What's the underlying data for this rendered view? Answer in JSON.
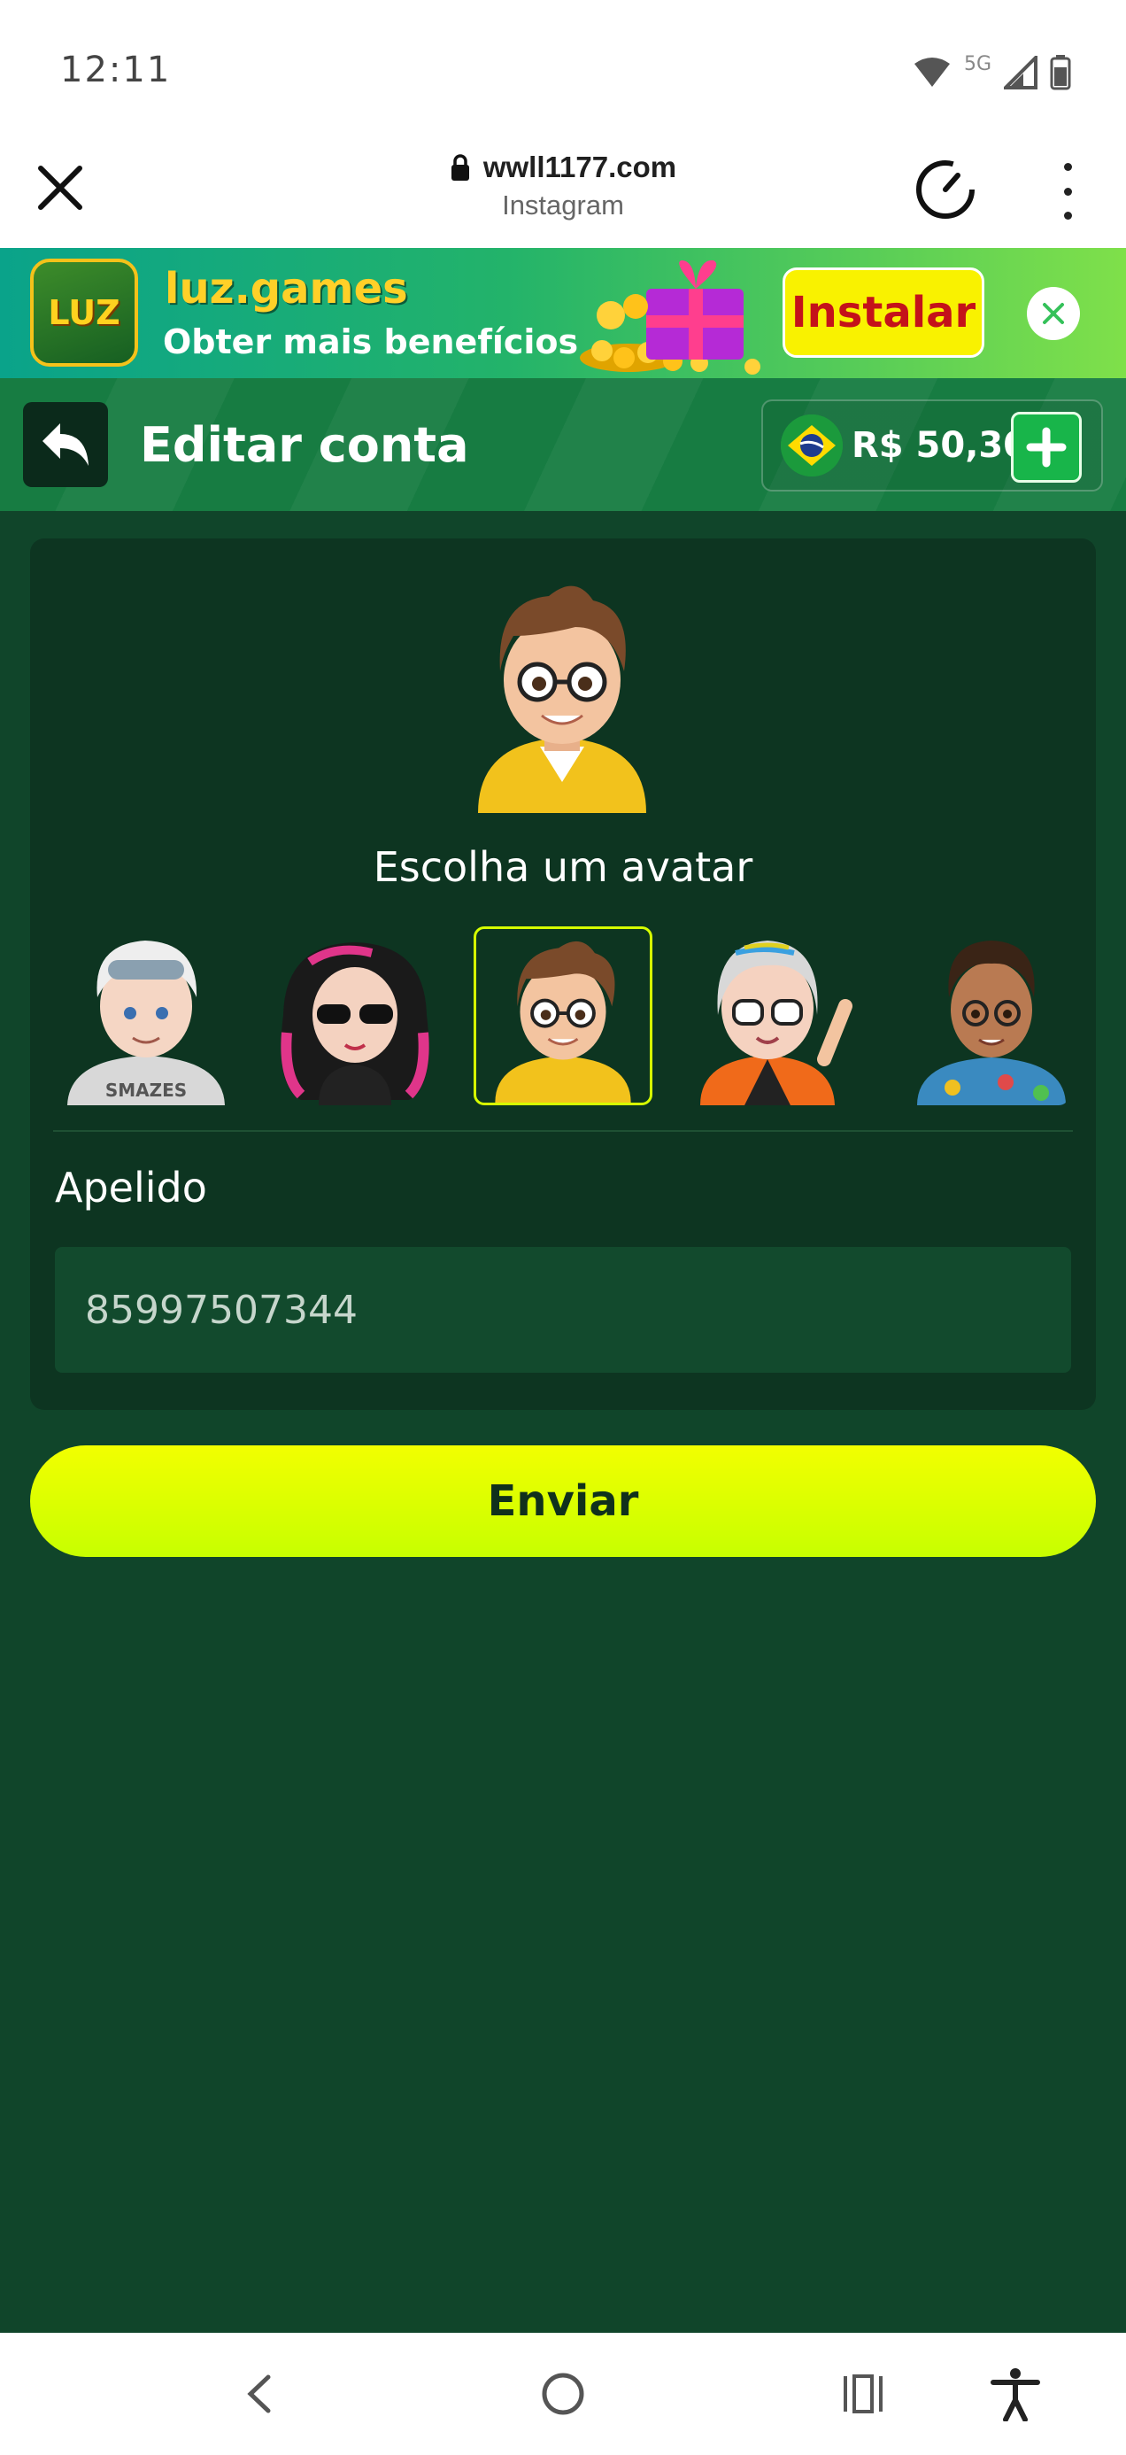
{
  "status_bar": {
    "time": "12:11",
    "network": "5G",
    "icons": [
      "wifi-icon",
      "signal-icon",
      "battery-icon"
    ]
  },
  "browser": {
    "url": "wwll1177.com",
    "referrer": "Instagram"
  },
  "install_banner": {
    "app_name": "luz.games",
    "tagline": "Obter mais benefícios",
    "install_label": "Instalar",
    "logo_text": "LUZ"
  },
  "header": {
    "title": "Editar conta",
    "balance": "R$ 50,30",
    "currency_flag": "brazil-flag-icon"
  },
  "profile": {
    "choose_avatar_label": "Escolha um avatar",
    "avatars": [
      "avatar-white-hair",
      "avatar-pink-hair",
      "avatar-brown-hair-glasses",
      "avatar-gray-hair-waving",
      "avatar-curly-hair"
    ],
    "selected_avatar_index": 2,
    "nickname_label": "Apelido",
    "nickname_value": "85997507344"
  },
  "actions": {
    "submit_label": "Enviar"
  },
  "colors": {
    "background": "#10452a",
    "card": "#0d3521",
    "header": "#10783c",
    "accent": "#d6ff00"
  }
}
